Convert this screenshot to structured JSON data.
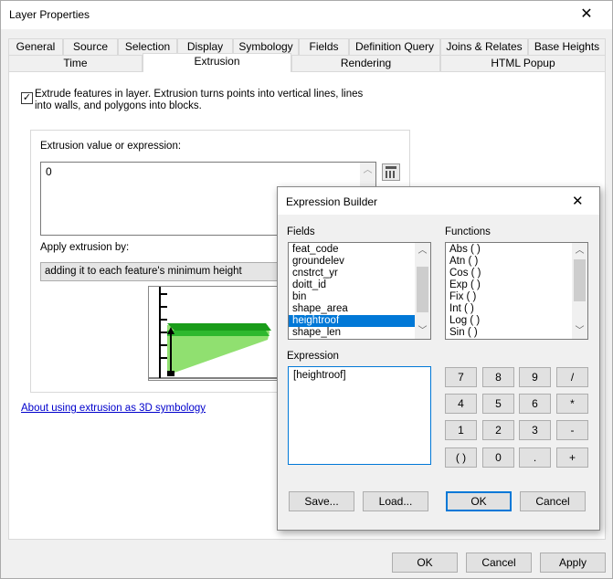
{
  "window": {
    "title": "Layer Properties",
    "close_glyph": "✕",
    "tabs_row1": [
      "General",
      "Source",
      "Selection",
      "Display",
      "Symbology",
      "Fields",
      "Definition Query",
      "Joins & Relates",
      "Base Heights"
    ],
    "tabs_row2": [
      "Time",
      "Extrusion",
      "Rendering",
      "HTML Popup"
    ],
    "active_tab": "Extrusion",
    "ok_label": "OK",
    "cancel_label": "Cancel",
    "apply_label": "Apply"
  },
  "extrusion": {
    "checkbox_checked": true,
    "checkbox_label": "Extrude features in layer.  Extrusion turns points into vertical lines, lines into walls, and polygons into blocks.",
    "value_label": "Extrusion value or expression:",
    "value": "0",
    "calculator_icon": "calculator-icon",
    "apply_by_label": "Apply extrusion by:",
    "apply_by_value": "adding it to each feature's minimum height",
    "help_link": "About using extrusion as 3D symbology"
  },
  "expression_builder": {
    "title": "Expression Builder",
    "close_glyph": "✕",
    "fields_label": "Fields",
    "fields": [
      "feat_code",
      "groundelev",
      "cnstrct_yr",
      "doitt_id",
      "bin",
      "shape_area",
      "heightroof",
      "shape_len"
    ],
    "selected_field": "heightroof",
    "functions_label": "Functions",
    "functions": [
      "Abs ( )",
      "Atn ( )",
      "Cos ( )",
      "Exp ( )",
      "Fix ( )",
      "Int ( )",
      "Log ( )",
      "Sin ( )"
    ],
    "expression_label": "Expression",
    "expression": "[heightroof]",
    "keypad": [
      "7",
      "8",
      "9",
      "/",
      "4",
      "5",
      "6",
      "*",
      "1",
      "2",
      "3",
      "-",
      "( )",
      "0",
      ".",
      "+"
    ],
    "save_label": "Save...",
    "load_label": "Load...",
    "ok_label": "OK",
    "cancel_label": "Cancel"
  },
  "colors": {
    "accent": "#0078d7",
    "extrusion_green": "#1a9c1a",
    "extrusion_light_green": "#90e070"
  }
}
